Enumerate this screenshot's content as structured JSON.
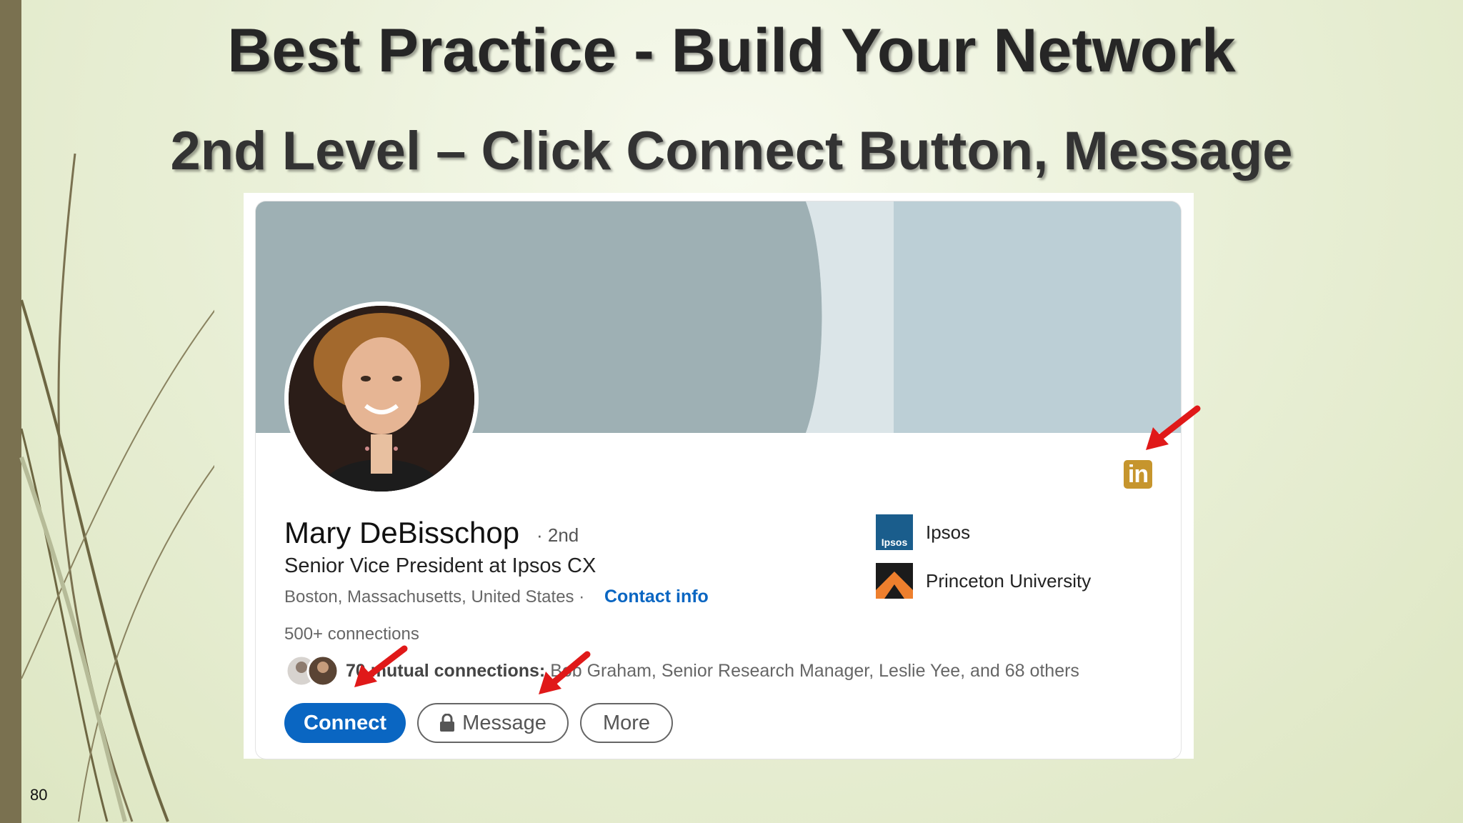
{
  "slide": {
    "title": "Best Practice - Build Your Network",
    "subtitle": "2nd Level – Click Connect Button, Message",
    "page_number": "80"
  },
  "profile": {
    "name": "Mary DeBisschop",
    "degree": "· 2nd",
    "headline": "Senior Vice President at Ipsos CX",
    "location": "Boston, Massachusetts, United States ·",
    "contact_info_label": "Contact info",
    "connections": "500+ connections",
    "mutual_count": "70",
    "mutual_label": "mutual connections:",
    "mutual_names": "Bob Graham, Senior Research Manager, Leslie Yee, and 68 others",
    "linkedin_badge": "in"
  },
  "actions": {
    "connect_label": "Connect",
    "message_label": "Message",
    "more_label": "More"
  },
  "organizations": [
    {
      "name": "Ipsos",
      "logo_text": "Ipsos"
    },
    {
      "name": "Princeton University"
    }
  ],
  "colors": {
    "accent": "#0a66c2",
    "arrow": "#e01919",
    "badge": "#c6952d"
  }
}
